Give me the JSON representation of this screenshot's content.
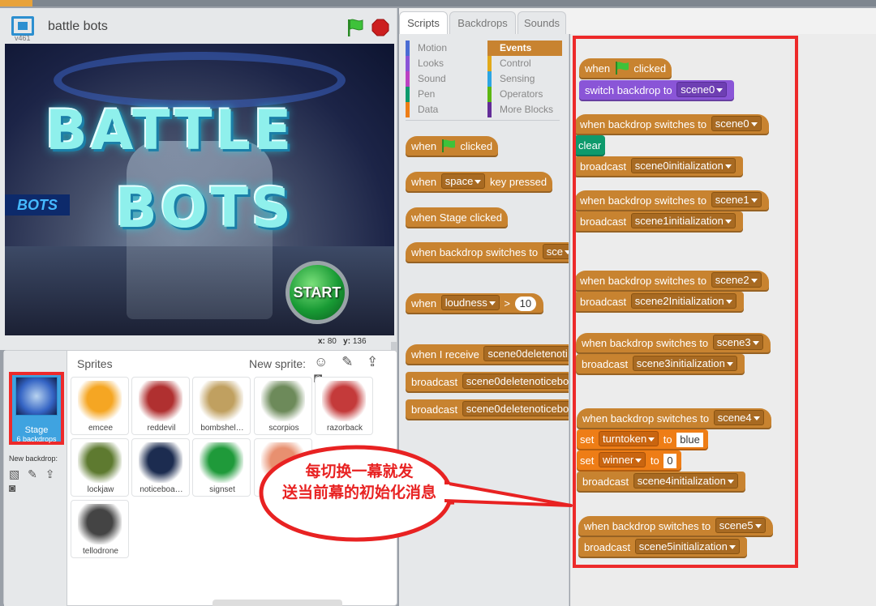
{
  "stage": {
    "title": "battle  bots",
    "version": "v461",
    "title_line1": "BATTLE",
    "title_line2": "BOTS",
    "side_sign": "BOTS",
    "start_button": "START",
    "coord_x_label": "x:",
    "coord_x": "80",
    "coord_y_label": "y:",
    "coord_y": "136"
  },
  "tabs": [
    {
      "label": "Scripts",
      "active": true
    },
    {
      "label": "Backdrops",
      "active": false
    },
    {
      "label": "Sounds",
      "active": false
    }
  ],
  "categories": [
    {
      "label": "Motion",
      "color": "#4a6cd4"
    },
    {
      "label": "Looks",
      "color": "#8a55d7"
    },
    {
      "label": "Sound",
      "color": "#bb42c3"
    },
    {
      "label": "Pen",
      "color": "#0e9a6c"
    },
    {
      "label": "Data",
      "color": "#ee7d16"
    },
    {
      "label": "Events",
      "color": "#c88330",
      "active": true
    },
    {
      "label": "Control",
      "color": "#e1a91a"
    },
    {
      "label": "Sensing",
      "color": "#2ca5e2"
    },
    {
      "label": "Operators",
      "color": "#5cb712"
    },
    {
      "label": "More Blocks",
      "color": "#632d99"
    }
  ],
  "palette": {
    "when_label": "when",
    "clicked_label": "clicked",
    "key_space": "space",
    "key_pressed": "key pressed",
    "stage_clicked": "when Stage clicked",
    "backdrop_switches": "when backdrop switches to",
    "backdrop_dd": "sce",
    "loudness": "loudness",
    "gt": ">",
    "loudness_value": "10",
    "when_i_receive": "when I receive",
    "receive_dd": "scene0deletenoti",
    "broadcast": "broadcast",
    "broadcast_dd": "scene0deletenoticebo",
    "broadcast_wait_dd": "scene0deletenoticebo"
  },
  "sprites_pane": {
    "title": "Sprites",
    "new_sprite": "New sprite:",
    "new_sprite_icons": "☺ ✎ ⇪ ◙",
    "stage_label": "Stage",
    "stage_backdrops": "6 backdrops",
    "new_backdrop": "New backdrop:",
    "new_backdrop_icons": "▧ ✎ ⇪ ◙",
    "sprites": [
      {
        "name": "emcee",
        "color": "#f5a623"
      },
      {
        "name": "reddevil",
        "color": "#b03030"
      },
      {
        "name": "bombshel…",
        "color": "#c0a060"
      },
      {
        "name": "scorpios",
        "color": "#6d8a5a"
      },
      {
        "name": "razorback",
        "color": "#c43a3a"
      },
      {
        "name": "lockjaw",
        "color": "#5e7a30"
      },
      {
        "name": "noticeboa…",
        "color": "#1c2c50"
      },
      {
        "name": "signset",
        "color": "#1f9a3a"
      },
      {
        "name": "",
        "color": "#e89070"
      },
      {
        "name": "tellodrone",
        "color": "#444444"
      }
    ]
  },
  "scripts": {
    "when": "when",
    "clicked": "clicked",
    "switch_backdrop_to": "switch backdrop to",
    "scene0": "scene0",
    "backdrop_switches_to": "when backdrop switches to",
    "clear": "clear",
    "broadcast": "broadcast",
    "scene0init": "scene0initialization",
    "scene1": "scene1",
    "scene1init": "scene1initialization",
    "scene2": "scene2",
    "scene2init": "scene2Initialization",
    "scene3": "scene3",
    "scene3init": "scene3initialization",
    "scene4": "scene4",
    "set": "set",
    "turntoken": "turntoken",
    "to": "to",
    "blue": "blue",
    "winner": "winner",
    "zero": "0",
    "scene4init": "scene4initialization",
    "scene5": "scene5",
    "scene5init": "scene5initialization"
  },
  "callout": {
    "line1": "每切换一幕就发",
    "line2": "送当前幕的初始化消息",
    "color": "#e82222"
  }
}
